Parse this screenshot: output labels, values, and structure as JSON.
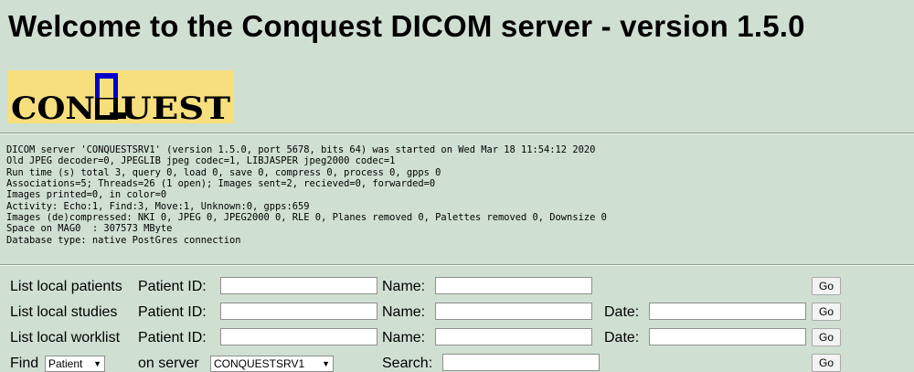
{
  "page": {
    "title": "Welcome to the Conquest DICOM server - version 1.5.0"
  },
  "logo": {
    "text": "CONQUEST"
  },
  "status_lines": [
    "DICOM server 'CONQUESTSRV1' (version 1.5.0, port 5678, bits 64) was started on Wed Mar 18 11:54:12 2020",
    "Old JPEG decoder=0, JPEGLIB jpeg codec=1, LIBJASPER jpeg2000 codec=1",
    "Run time (s) total 3, query 0, load 0, save 0, compress 0, process 0, gpps 0",
    "Associations=5; Threads=26 (1 open); Images sent=2, recieved=0, forwarded=0",
    "Images printed=0, in color=0",
    "Activity: Echo:1, Find:3, Move:1, Unknown:0, gpps:659",
    "Images (de)compressed: NKI 0, JPEG 0, JPEG2000 0, RLE 0, Planes removed 0, Palettes removed 0, Downsize 0",
    "Space on MAG0  : 307573 MByte",
    "Database type: native PostGres connection"
  ],
  "forms": {
    "patients": {
      "label": "List local patients",
      "patient_id_label": "Patient ID:",
      "patient_id_value": "",
      "name_label": "Name:",
      "name_value": "",
      "go_label": "Go"
    },
    "studies": {
      "label": "List local studies",
      "patient_id_label": "Patient ID:",
      "patient_id_value": "",
      "name_label": "Name:",
      "name_value": "",
      "date_label": "Date:",
      "date_value": "",
      "go_label": "Go"
    },
    "worklist": {
      "label": "List local worklist",
      "patient_id_label": "Patient ID:",
      "patient_id_value": "",
      "name_label": "Name:",
      "name_value": "",
      "date_label": "Date:",
      "date_value": "",
      "go_label": "Go"
    },
    "find": {
      "label": "Find",
      "level_selected": "Patient",
      "on_server_label": "on server",
      "server_selected": "CONQUESTSRV1",
      "search_label": "Search:",
      "search_value": "",
      "go_label": "Go"
    }
  },
  "icons": {
    "dropdown": "▼"
  }
}
